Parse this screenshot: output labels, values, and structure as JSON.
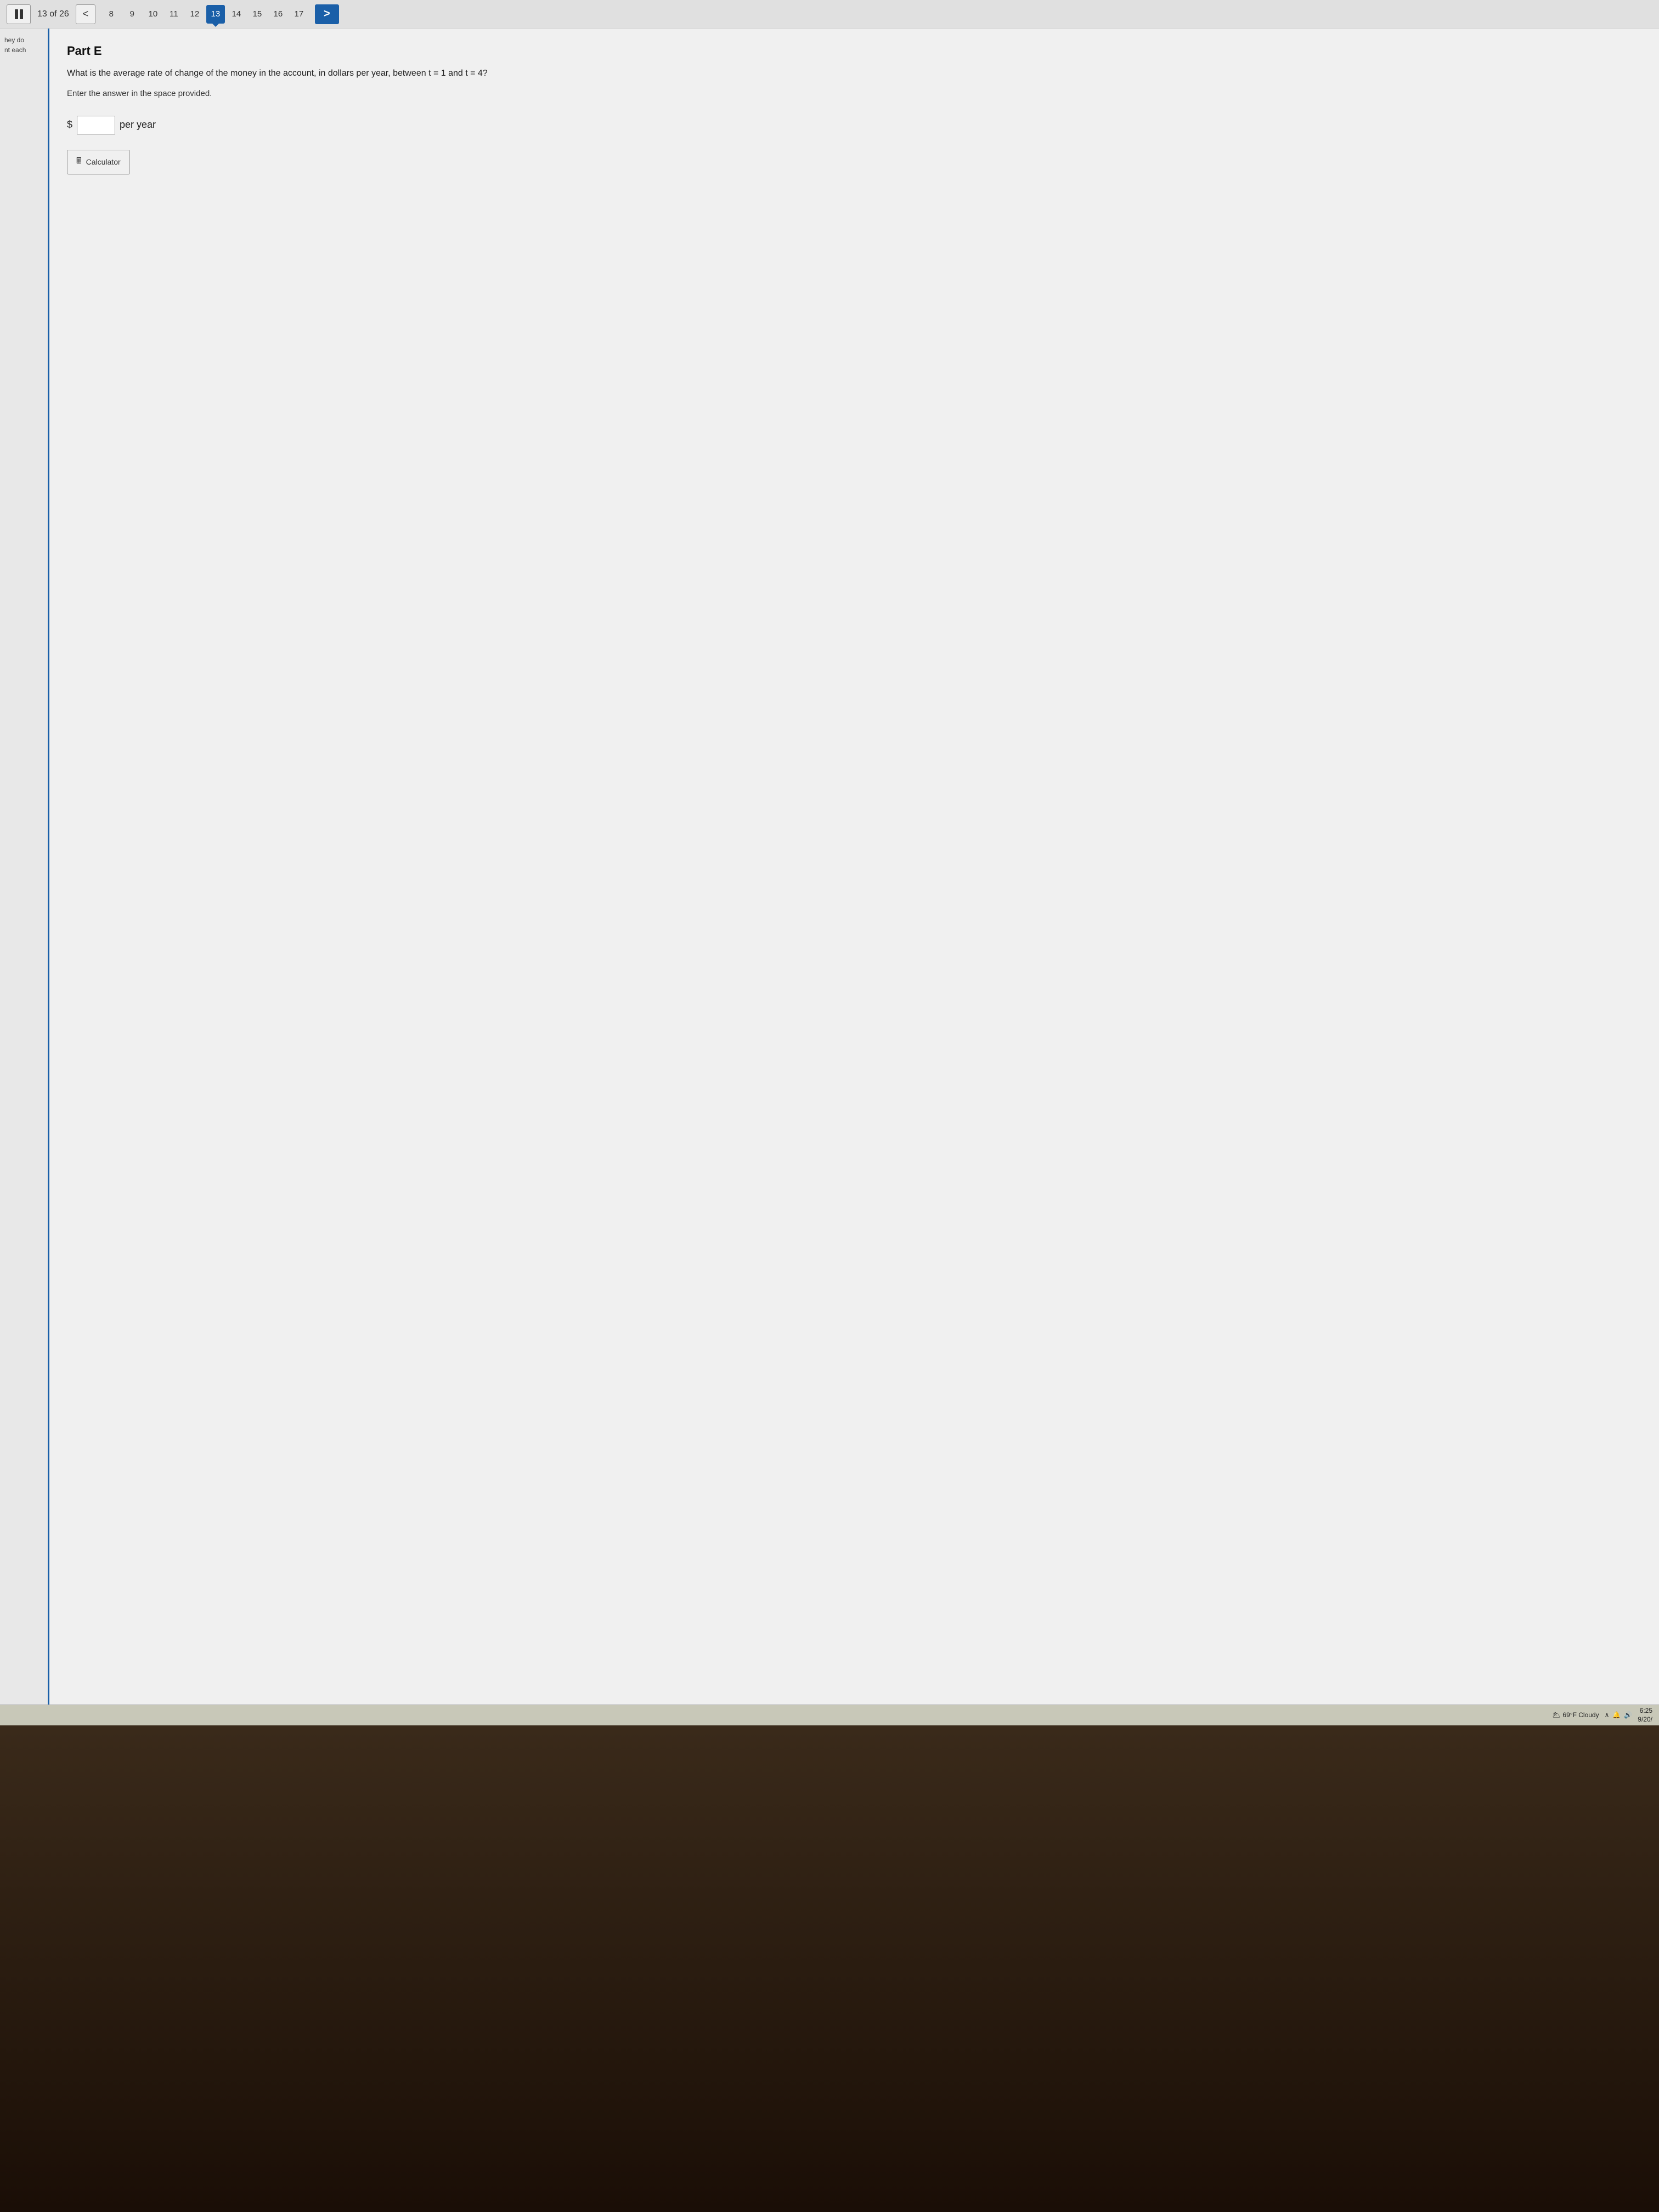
{
  "topNav": {
    "pageCounter": "13 of 26",
    "prevArrow": "<",
    "nextArrow": ">",
    "pageNumbers": [
      {
        "label": "8",
        "active": false
      },
      {
        "label": "9",
        "active": false
      },
      {
        "label": "10",
        "active": false
      },
      {
        "label": "11",
        "active": false
      },
      {
        "label": "12",
        "active": false
      },
      {
        "label": "13",
        "active": true
      },
      {
        "label": "14",
        "active": false
      },
      {
        "label": "15",
        "active": false
      },
      {
        "label": "16",
        "active": false
      },
      {
        "label": "17",
        "active": false
      }
    ]
  },
  "sidebar": {
    "line1": "hey do",
    "line2": "nt each"
  },
  "main": {
    "partTitle": "Part E",
    "questionText": "What is the average rate of change of the money in the account, in dollars per year, between t  = 1 and t  = 4?",
    "instructionText": "Enter the answer in the space provided.",
    "dollarSign": "$",
    "perYearLabel": "per year",
    "answerPlaceholder": "",
    "calculatorLabel": "Calculator"
  },
  "taskbar": {
    "weather": "69°F  Cloudy",
    "time": "6:25",
    "date": "9/20/"
  }
}
